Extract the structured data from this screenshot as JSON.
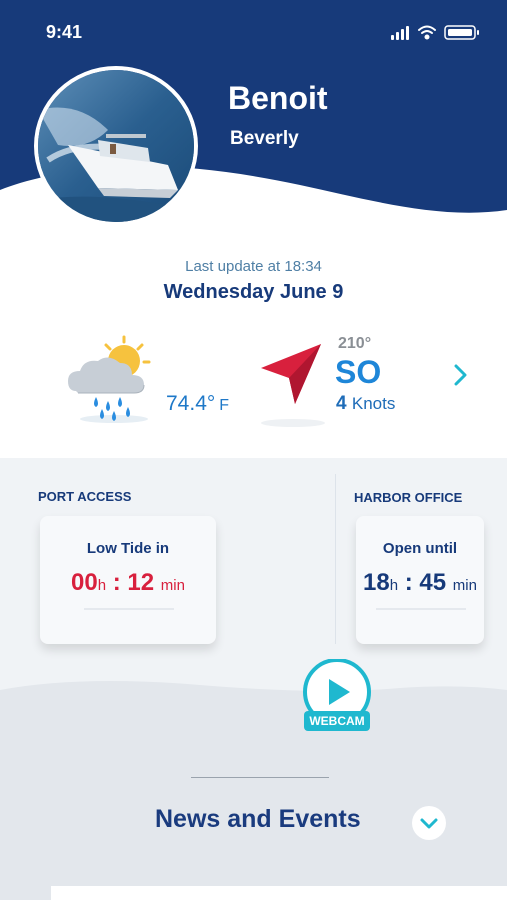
{
  "status": {
    "time": "9:41"
  },
  "profile": {
    "first_name": "Benoit",
    "last_name": "Beverly"
  },
  "update": {
    "label": "Last update at 18:34",
    "date": "Wednesday June 9"
  },
  "weather": {
    "temperature": "74.4°",
    "unit": "F",
    "icon": "rain-sun-cloud-icon"
  },
  "wind": {
    "degree": "210°",
    "direction": "SO",
    "speed": "4",
    "speed_unit": "Knots",
    "icon": "wind-arrow-icon"
  },
  "port_access": {
    "label": "PORT ACCESS",
    "card_title": "Low Tide in",
    "hours": "00",
    "hours_unit": "h",
    "sep": ":",
    "minutes": "12",
    "minutes_unit": "min"
  },
  "harbor_office": {
    "label": "HARBOR OFFICE",
    "card_title": "Open until",
    "hours": "18",
    "hours_unit": "h",
    "sep": ":",
    "minutes": "45",
    "minutes_unit": "min"
  },
  "webcam": {
    "label": "WEBCAM"
  },
  "news": {
    "title": "News and Events"
  },
  "colors": {
    "header_blue": "#173a7a",
    "accent_red": "#d8203d",
    "accent_cyan": "#1fb8cf",
    "text_blue": "#1e78c8"
  }
}
